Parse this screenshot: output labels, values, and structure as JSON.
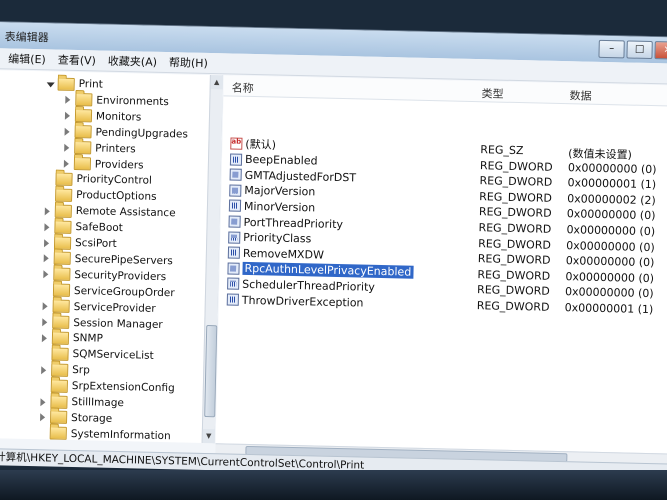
{
  "window": {
    "title": "表编辑器",
    "controls": [
      "–",
      "□",
      "×"
    ]
  },
  "menu": [
    {
      "label": "编辑(E)"
    },
    {
      "label": "查看(V)"
    },
    {
      "label": "收藏夹(A)"
    },
    {
      "label": "帮助(H)"
    }
  ],
  "tree": {
    "items": [
      {
        "label": "Print",
        "level": 0,
        "expanded": true
      },
      {
        "label": "Environments",
        "level": 1,
        "expanded": false
      },
      {
        "label": "Monitors",
        "level": 1,
        "expanded": false
      },
      {
        "label": "PendingUpgrades",
        "level": 1,
        "expanded": false
      },
      {
        "label": "Printers",
        "level": 1,
        "expanded": false
      },
      {
        "label": "Providers",
        "level": 1,
        "expanded": false
      },
      {
        "label": "PriorityControl",
        "level": 0,
        "expanded": null
      },
      {
        "label": "ProductOptions",
        "level": 0,
        "expanded": null
      },
      {
        "label": "Remote Assistance",
        "level": 0,
        "expanded": false
      },
      {
        "label": "SafeBoot",
        "level": 0,
        "expanded": false
      },
      {
        "label": "ScsiPort",
        "level": 0,
        "expanded": false
      },
      {
        "label": "SecurePipeServers",
        "level": 0,
        "expanded": false
      },
      {
        "label": "SecurityProviders",
        "level": 0,
        "expanded": false
      },
      {
        "label": "ServiceGroupOrder",
        "level": 0,
        "expanded": null
      },
      {
        "label": "ServiceProvider",
        "level": 0,
        "expanded": false
      },
      {
        "label": "Session Manager",
        "level": 0,
        "expanded": false
      },
      {
        "label": "SNMP",
        "level": 0,
        "expanded": false
      },
      {
        "label": "SQMServiceList",
        "level": 0,
        "expanded": null
      },
      {
        "label": "Srp",
        "level": 0,
        "expanded": false
      },
      {
        "label": "SrpExtensionConfig",
        "level": 0,
        "expanded": null
      },
      {
        "label": "StillImage",
        "level": 0,
        "expanded": false
      },
      {
        "label": "Storage",
        "level": 0,
        "expanded": false
      },
      {
        "label": "SystemInformation",
        "level": 0,
        "expanded": null
      }
    ]
  },
  "list": {
    "columns": {
      "name": "名称",
      "type": "类型",
      "data": "数据"
    },
    "rows": [
      {
        "name": "(默认)",
        "type": "REG_SZ",
        "data": "(数值未设置)",
        "icon": "string-value-icon",
        "selected": false
      },
      {
        "name": "BeepEnabled",
        "type": "REG_DWORD",
        "data": "0x00000000 (0)",
        "icon": "binary-value-icon",
        "selected": false
      },
      {
        "name": "GMTAdjustedForDST",
        "type": "REG_DWORD",
        "data": "0x00000001 (1)",
        "icon": "binary-value-icon",
        "selected": false
      },
      {
        "name": "MajorVersion",
        "type": "REG_DWORD",
        "data": "0x00000002 (2)",
        "icon": "binary-value-icon",
        "selected": false
      },
      {
        "name": "MinorVersion",
        "type": "REG_DWORD",
        "data": "0x00000000 (0)",
        "icon": "binary-value-icon",
        "selected": false
      },
      {
        "name": "PortThreadPriority",
        "type": "REG_DWORD",
        "data": "0x00000000 (0)",
        "icon": "binary-value-icon",
        "selected": false
      },
      {
        "name": "PriorityClass",
        "type": "REG_DWORD",
        "data": "0x00000000 (0)",
        "icon": "binary-value-icon",
        "selected": false
      },
      {
        "name": "RemoveMXDW",
        "type": "REG_DWORD",
        "data": "0x00000000 (0)",
        "icon": "binary-value-icon",
        "selected": false
      },
      {
        "name": "RpcAuthnLevelPrivacyEnabled",
        "type": "REG_DWORD",
        "data": "0x00000000 (0)",
        "icon": "binary-value-icon",
        "selected": true
      },
      {
        "name": "SchedulerThreadPriority",
        "type": "REG_DWORD",
        "data": "0x00000000 (0)",
        "icon": "binary-value-icon",
        "selected": false
      },
      {
        "name": "ThrowDriverException",
        "type": "REG_DWORD",
        "data": "0x00000001 (1)",
        "icon": "binary-value-icon",
        "selected": false
      }
    ]
  },
  "status": {
    "path": "计算机\\HKEY_LOCAL_MACHINE\\SYSTEM\\CurrentControlSet\\Control\\Print"
  },
  "colors": {
    "selection": "#3067c8",
    "folder": "#e8bd4a"
  }
}
